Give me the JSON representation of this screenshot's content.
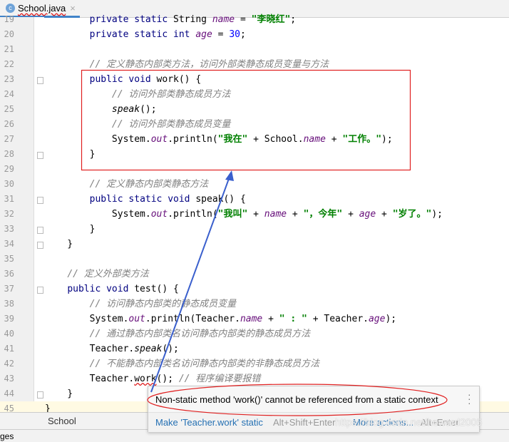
{
  "tab": {
    "icon": "class-c-icon",
    "icon_letter": "c",
    "title": "School.java",
    "close": "×"
  },
  "code_lines": [
    {
      "n": "19",
      "t": [
        [
          "t",
          "        "
        ],
        [
          "k",
          "private static "
        ],
        [
          "t",
          "String "
        ],
        [
          "f",
          "name"
        ],
        [
          "t",
          " = "
        ],
        [
          "s",
          "\"李晓红\""
        ],
        [
          "t",
          ";"
        ]
      ]
    },
    {
      "n": "20",
      "t": [
        [
          "t",
          "        "
        ],
        [
          "k",
          "private static int "
        ],
        [
          "f",
          "age"
        ],
        [
          "t",
          " = "
        ],
        [
          "n",
          "30"
        ],
        [
          "t",
          ";"
        ]
      ]
    },
    {
      "n": "21",
      "t": []
    },
    {
      "n": "22",
      "t": [
        [
          "t",
          "        "
        ],
        [
          "c",
          "// 定义静态内部类方法，访问外部类静态成员变量与方法"
        ]
      ]
    },
    {
      "n": "23",
      "t": [
        [
          "t",
          "        "
        ],
        [
          "k",
          "public void "
        ],
        [
          "t",
          "work() {"
        ]
      ]
    },
    {
      "n": "24",
      "t": [
        [
          "t",
          "            "
        ],
        [
          "c",
          "// 访问外部类静态成员方法"
        ]
      ]
    },
    {
      "n": "25",
      "t": [
        [
          "t",
          "            "
        ],
        [
          "m",
          "speak"
        ],
        [
          "t",
          "();"
        ]
      ]
    },
    {
      "n": "26",
      "t": [
        [
          "t",
          "            "
        ],
        [
          "c",
          "// 访问外部类静态成员变量"
        ]
      ]
    },
    {
      "n": "27",
      "t": [
        [
          "t",
          "            System."
        ],
        [
          "f",
          "out"
        ],
        [
          "t",
          ".println("
        ],
        [
          "s",
          "\"我在\""
        ],
        [
          "t",
          " + School."
        ],
        [
          "f",
          "name"
        ],
        [
          "t",
          " + "
        ],
        [
          "s",
          "\"工作。\""
        ],
        [
          "t",
          ");"
        ]
      ]
    },
    {
      "n": "28",
      "t": [
        [
          "t",
          "        }"
        ]
      ]
    },
    {
      "n": "29",
      "t": []
    },
    {
      "n": "30",
      "t": [
        [
          "t",
          "        "
        ],
        [
          "c",
          "// 定义静态内部类静态方法"
        ]
      ]
    },
    {
      "n": "31",
      "t": [
        [
          "t",
          "        "
        ],
        [
          "k",
          "public static void "
        ],
        [
          "t",
          "speak() {"
        ]
      ]
    },
    {
      "n": "32",
      "t": [
        [
          "t",
          "            System."
        ],
        [
          "f",
          "out"
        ],
        [
          "t",
          ".println("
        ],
        [
          "s",
          "\"我叫\""
        ],
        [
          "t",
          " + "
        ],
        [
          "f",
          "name"
        ],
        [
          "t",
          " + "
        ],
        [
          "s",
          "\"，今年\""
        ],
        [
          "t",
          " + "
        ],
        [
          "f",
          "age"
        ],
        [
          "t",
          " + "
        ],
        [
          "s",
          "\"岁了。\""
        ],
        [
          "t",
          ");"
        ]
      ]
    },
    {
      "n": "33",
      "t": [
        [
          "t",
          "        }"
        ]
      ]
    },
    {
      "n": "34",
      "t": [
        [
          "t",
          "    }"
        ]
      ]
    },
    {
      "n": "35",
      "t": []
    },
    {
      "n": "36",
      "t": [
        [
          "t",
          "    "
        ],
        [
          "c",
          "// 定义外部类方法"
        ]
      ]
    },
    {
      "n": "37",
      "t": [
        [
          "t",
          "    "
        ],
        [
          "k",
          "public void "
        ],
        [
          "t",
          "test() {"
        ]
      ]
    },
    {
      "n": "38",
      "t": [
        [
          "t",
          "        "
        ],
        [
          "c",
          "// 访问静态内部类的静态成员变量"
        ]
      ]
    },
    {
      "n": "39",
      "t": [
        [
          "t",
          "        System."
        ],
        [
          "f",
          "out"
        ],
        [
          "t",
          ".println(Teacher."
        ],
        [
          "f",
          "name"
        ],
        [
          "t",
          " + "
        ],
        [
          "s",
          "\" : \""
        ],
        [
          "t",
          " + Teacher."
        ],
        [
          "f",
          "age"
        ],
        [
          "t",
          ");"
        ]
      ]
    },
    {
      "n": "40",
      "t": [
        [
          "t",
          "        "
        ],
        [
          "c",
          "// 通过静态内部类名访问静态内部类的静态成员方法"
        ]
      ]
    },
    {
      "n": "41",
      "t": [
        [
          "t",
          "        Teacher."
        ],
        [
          "m",
          "speak"
        ],
        [
          "t",
          "();"
        ]
      ]
    },
    {
      "n": "42",
      "t": [
        [
          "t",
          "        "
        ],
        [
          "c",
          "// 不能静态内部类名访问静态内部类的非静态成员方法"
        ]
      ]
    },
    {
      "n": "43",
      "t": [
        [
          "t",
          "        Teacher."
        ],
        [
          "err",
          "work"
        ],
        [
          "t",
          "(); "
        ],
        [
          "c",
          "// 程序编译要报错"
        ]
      ]
    },
    {
      "n": "44",
      "t": [
        [
          "t",
          "    }"
        ]
      ]
    },
    {
      "n": "45",
      "t": [
        [
          "t",
          "}"
        ]
      ]
    }
  ],
  "breadcrumb": {
    "item": "School"
  },
  "status": {
    "text": "ges"
  },
  "popup": {
    "message": "Non-static method 'work()' cannot be referenced from a static context",
    "menu_icon": "more-vertical-icon",
    "action1": "Make 'Teacher.work' static",
    "action1_shortcut": "Alt+Shift+Enter",
    "action2": "More actions...",
    "action2_shortcut": "Alt+Enter"
  },
  "watermark": "https://blog.csdn.net/howard2005",
  "annotation_colors": {
    "box": "#e02020",
    "arrow": "#3a5fcd",
    "ellipse": "#e02020"
  }
}
